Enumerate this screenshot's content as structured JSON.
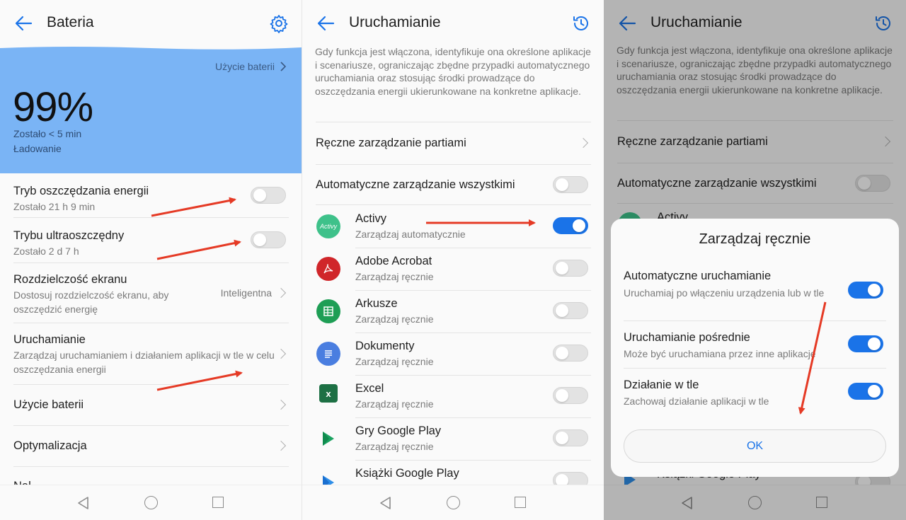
{
  "colors": {
    "accent": "#1a73e8",
    "battery_card": "#7ab4f5",
    "arrow": "#e53a25"
  },
  "panel1": {
    "title": "Bateria",
    "battery": {
      "usage_link": "Użycie baterii",
      "percent": "99%",
      "remaining": "Zostało < 5 min",
      "status": "Ładowanie"
    },
    "rows": [
      {
        "label": "Tryb oszczędzania energii",
        "sub": "Zostało 21 h 9 min",
        "toggle": false
      },
      {
        "label": "Trybu ultraoszczędny",
        "sub": "Zostało 2 d 7 h",
        "toggle": false
      },
      {
        "label": "Rozdzielczość ekranu",
        "sub": "Dostosuj rozdzielczość ekranu, aby oszczędzić energię",
        "value": "Inteligentna"
      },
      {
        "label": "Uruchamianie",
        "sub": "Zarządzaj uruchamianiem i działaniem aplikacji w tle w celu oszczędzania energii"
      },
      {
        "label": "Użycie baterii"
      },
      {
        "label": "Optymalizacja"
      },
      {
        "label": "Nal...",
        "value": "..."
      }
    ]
  },
  "panel2": {
    "title": "Uruchamianie",
    "description": "Gdy funkcja jest włączona, identyfikuje ona określone aplikacje i scenariusze, ograniczając zbędne przypadki automatycznego uruchamiania oraz stosując środki prowadzące do oszczędzania energii ukierunkowane na konkretne aplikacje.",
    "manual_batch": "Ręczne zarządzanie partiami",
    "auto_all": "Automatyczne zarządzanie wszystkimi",
    "apps": [
      {
        "name": "Activy",
        "status": "Zarządzaj automatycznie",
        "on": true,
        "icon": "activy-icon",
        "icon_text": "Activy"
      },
      {
        "name": "Adobe Acrobat",
        "status": "Zarządzaj ręcznie",
        "on": false,
        "icon": "acrobat-icon"
      },
      {
        "name": "Arkusze",
        "status": "Zarządzaj ręcznie",
        "on": false,
        "icon": "sheets-icon"
      },
      {
        "name": "Dokumenty",
        "status": "Zarządzaj ręcznie",
        "on": false,
        "icon": "docs-icon"
      },
      {
        "name": "Excel",
        "status": "Zarządzaj ręcznie",
        "on": false,
        "icon": "excel-icon",
        "icon_text": "x"
      },
      {
        "name": "Gry Google Play",
        "status": "Zarządzaj ręcznie",
        "on": false,
        "icon": "play-games-icon"
      },
      {
        "name": "Książki Google Play",
        "status": "",
        "on": false,
        "icon": "play-books-icon"
      }
    ]
  },
  "panel3": {
    "title": "Uruchamianie",
    "description": "Gdy funkcja jest włączona, identyfikuje ona określone aplikacje i scenariusze, ograniczając zbędne przypadki automatycznego uruchamiania oraz stosując środki prowadzące do oszczędzania energii ukierunkowane na konkretne aplikacje.",
    "manual_batch": "Ręczne zarządzanie partiami",
    "auto_all": "Automatyczne zarządzanie wszystkimi",
    "peek_app": "Activy",
    "bottom_peek": "Książki Google Play",
    "dialog": {
      "title": "Zarządzaj ręcznie",
      "options": [
        {
          "label": "Automatyczne uruchamianie",
          "sub": "Uruchamiaj po włączeniu urządzenia lub w tle",
          "on": true
        },
        {
          "label": "Uruchamianie pośrednie",
          "sub": "Może być uruchamiana przez inne aplikacje",
          "on": true
        },
        {
          "label": "Działanie w tle",
          "sub": "Zachowaj działanie aplikacji w tle",
          "on": true
        }
      ],
      "ok_label": "OK"
    }
  }
}
